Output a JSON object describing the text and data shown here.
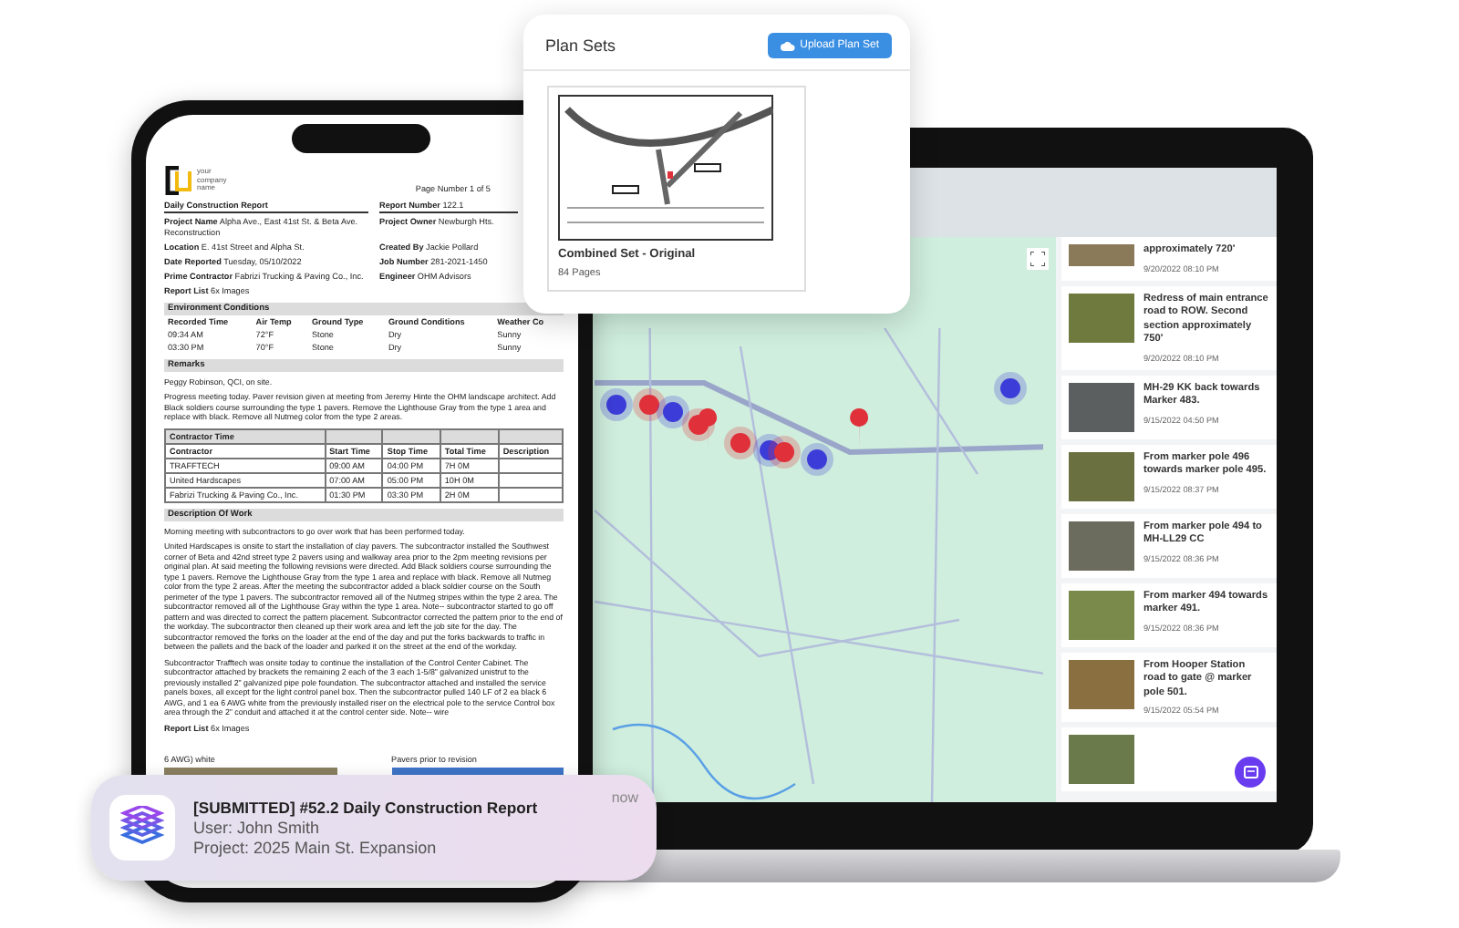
{
  "plan_sets": {
    "title": "Plan Sets",
    "upload_button": "Upload Plan Set",
    "plan": {
      "name": "Combined Set - Original",
      "pages": "84 Pages"
    }
  },
  "report": {
    "logo_text": "your company name",
    "page_number": "Page Number 1 of 5",
    "fields": [
      {
        "label": "Daily Construction Report"
      },
      {
        "label": "Report Number",
        "value": "122.1"
      },
      {
        "label": "Project Name",
        "value": "Alpha Ave., East 41st St. & Beta Ave. Reconstruction"
      },
      {
        "label": "Project Owner",
        "value": "Newburgh Hts."
      },
      {
        "label": "Location",
        "value": "E. 41st Street and Alpha St."
      },
      {
        "label": "Created By",
        "value": "Jackie Pollard"
      },
      {
        "label": "Date Reported",
        "value": "Tuesday, 05/10/2022"
      },
      {
        "label": "Job Number",
        "value": "281-2021-1450"
      },
      {
        "label": "Prime Contractor",
        "value": "Fabrizi Trucking & Paving Co., Inc."
      },
      {
        "label": "Engineer",
        "value": "OHM Advisors"
      },
      {
        "label": "Report List",
        "value": "6x Images"
      }
    ],
    "environment": {
      "title": "Environment Conditions",
      "columns": [
        "Recorded Time",
        "Air Temp",
        "Ground Type",
        "Ground Conditions",
        "Weather Co"
      ],
      "rows": [
        [
          "09:34 AM",
          "72°F",
          "Stone",
          "Dry",
          "Sunny"
        ],
        [
          "03:30 PM",
          "70°F",
          "Stone",
          "Dry",
          "Sunny"
        ]
      ]
    },
    "remarks": {
      "title": "Remarks",
      "lines": [
        "Peggy Robinson, QCI, on site.",
        "Progress meeting today. Paver revision given at meeting from Jeremy Hinte the OHM landscape architect. Add Black soldiers course surrounding the type 1 pavers. Remove the Lighthouse Gray from the type 1 area and replace with black. Remove all Nutmeg color from the type 2 areas."
      ]
    },
    "contractor_time": {
      "title": "Contractor Time",
      "columns": [
        "Contractor",
        "Start Time",
        "Stop Time",
        "Total Time",
        "Description"
      ],
      "rows": [
        [
          "TRAFFTECH",
          "09:00 AM",
          "04:00 PM",
          "7H 0M",
          ""
        ],
        [
          "United Hardscapes",
          "07:00 AM",
          "05:00 PM",
          "10H 0M",
          ""
        ],
        [
          "Fabrizi Trucking & Paving Co., Inc.",
          "01:30 PM",
          "03:30 PM",
          "2H 0M",
          ""
        ]
      ]
    },
    "work": {
      "title": "Description Of Work",
      "lines": [
        "Morning meeting with subcontractors to go over work that has been performed today.",
        "United Hardscapes is onsite to start the installation of clay pavers. The subcontractor installed the Southwest corner of Beta and 42nd street type 2 pavers using and walkway area prior to the 2pm meeting revisions per original plan. At said meeting the following revisions were directed. Add Black soldiers course surrounding the type 1 pavers. Remove the Lighthouse Gray from the type 1 area and replace with black. Remove all Nutmeg color from the type 2 areas. After the meeting the subcontractor added a black soldier course on the South perimeter of the type 1 pavers. The subcontractor removed all of the Nutmeg stripes within the type 2 area. The subcontractor removed all of the Lighthouse Gray within the type 1 area. Note-- subcontractor started to go off pattern and was directed to correct the pattern placement. Subcontractor corrected the pattern prior to the end of the workday. The subcontractor then cleaned up their work area and left the job site for the day. The subcontractor removed the forks on the loader at the end of the day and put the forks backwards to traffic in between the pallets and the back of the loader and parked it on the street at the end of the workday.",
        "Subcontractor Trafftech was onsite today to continue the installation of the Control Center Cabinet. The subcontractor attached by brackets the remaining 2 each of the 3 each 1-5/8\" galvanized unistrut to the previously installed 2\" galvanized pipe pole foundation. The subcontractor attached and installed the service panels boxes, all except for the light control panel box. Then the subcontractor pulled 140 LF of 2 ea black 6 AWG, and 1 ea 6 AWG white from the previously installed riser on the electrical pole to the service Control box area through the 2\" conduit and attached it at the control center side. Note-- wire"
      ]
    },
    "report_list": {
      "label": "Report List",
      "value": "6x Images"
    },
    "photos": [
      "6 AWG) white",
      "Pavers prior to revision"
    ]
  },
  "photo_feed": [
    {
      "caption": "approximately 720'",
      "timestamp": "9/20/2022 08:10 PM"
    },
    {
      "caption": "Redress of main entrance road to ROW. Second section approximately 750'",
      "timestamp": "9/20/2022 08:10 PM"
    },
    {
      "caption": "MH-29 KK back towards Marker 483.",
      "timestamp": "9/15/2022 04:50 PM"
    },
    {
      "caption": "From marker pole 496 towards marker pole 495.",
      "timestamp": "9/15/2022 08:37 PM"
    },
    {
      "caption": "From marker pole 494 to MH-LL29 CC",
      "timestamp": "9/15/2022 08:36 PM"
    },
    {
      "caption": "From marker 494 towards marker 491.",
      "timestamp": "9/15/2022 08:36 PM"
    },
    {
      "caption": "From Hooper Station road to gate @ marker pole 501.",
      "timestamp": "9/15/2022 05:54 PM"
    }
  ],
  "notification": {
    "title": "[SUBMITTED] #52.2 Daily Construction Report",
    "user": "User: John Smith",
    "project": "Project: 2025 Main St. Expansion",
    "time": "now"
  }
}
